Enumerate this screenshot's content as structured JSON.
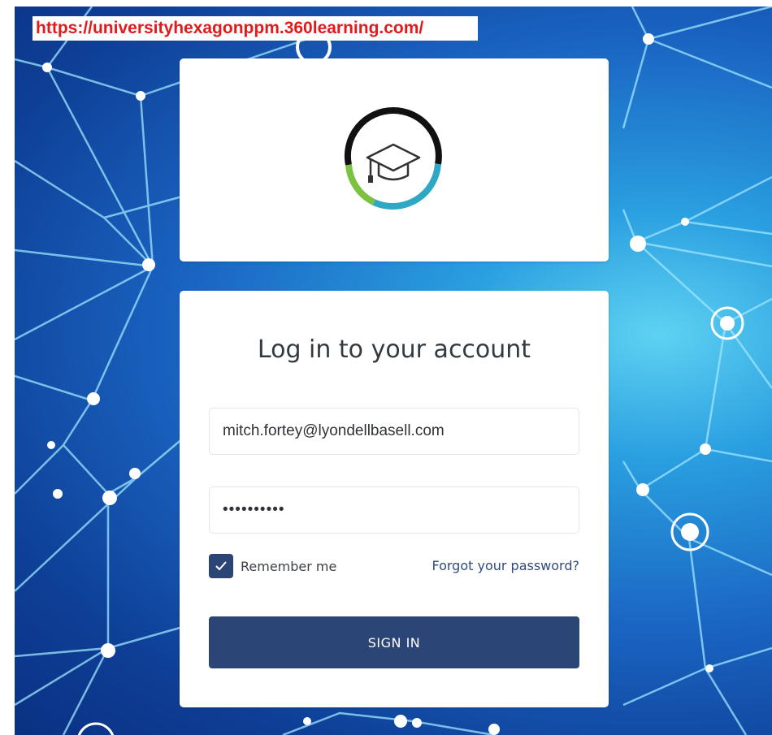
{
  "browser": {
    "url": "https://universityhexagonppm.360learning.com/"
  },
  "logo": {
    "icon": "graduation-cap-icon",
    "ring_colors": [
      "#111111",
      "#7cc142",
      "#2ea8c4"
    ]
  },
  "login": {
    "title": "Log in to your account",
    "email_value": "mitch.fortey@lyondellbasell.com",
    "password_value": "••••••••••",
    "remember_label": "Remember me",
    "remember_checked": true,
    "forgot_label": "Forgot your password?",
    "signin_label": "SIGN IN"
  },
  "colors": {
    "primary": "#2c4577",
    "url_text": "#e41a1a"
  }
}
